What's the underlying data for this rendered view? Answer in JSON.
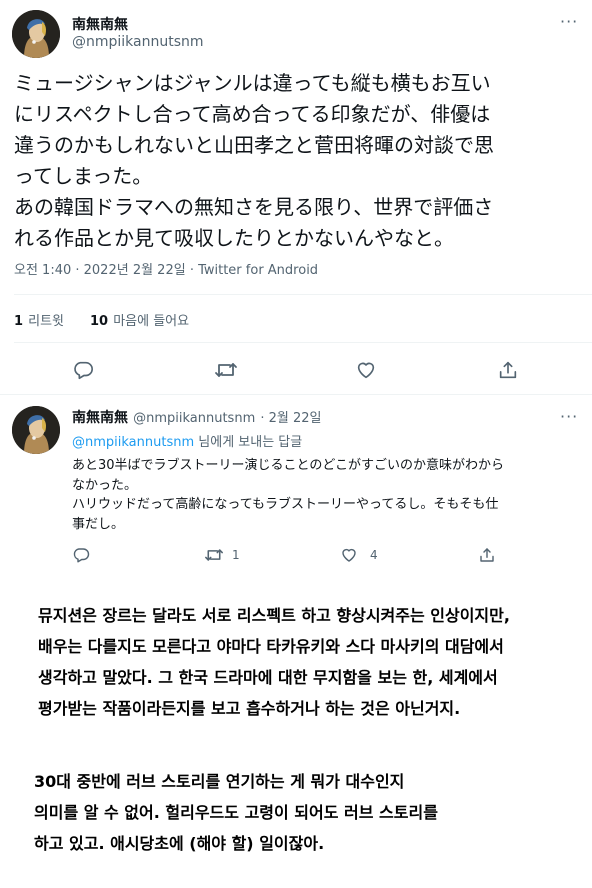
{
  "main_tweet": {
    "display_name": "南無南無",
    "handle": "@nmpiikannutsnm",
    "text": "ミュージシャンはジャンルは違っても縦も横もお互い\nにリスペクトし合って高め合ってる印象だが、俳優は\n違うのかもしれないと山田孝之と菅田将暉の対談で思\nってしまった。\nあの韓国ドラマへの無知さを見る限り、世界で評価さ\nれる作品とか見て吸収したりとかないんやなと。",
    "timestamp": "오전 1:40 · 2022년 2월 22일 · Twitter for Android",
    "retweets_count": "1",
    "retweets_label": "리트윗",
    "likes_count": "10",
    "likes_label": "마음에 들어요"
  },
  "reply_tweet": {
    "display_name": "南無南無",
    "handle": "@nmpiikannutsnm",
    "date": "· 2월 22일",
    "reply_to_mention": "@nmpiikannutsnm",
    "reply_to_suffix": " 님에게 보내는 답글",
    "text": "あと30半ばでラブストーリー演じることのどこがすごいのか意味がわから\nなかった。\nハリウッドだって高齢になってもラブストーリーやってるし。そもそも仕\n事だし。",
    "retweets_count": "1",
    "likes_count": "4"
  },
  "translation": {
    "paragraph1": "뮤지션은 장르는 달라도 서로 리스펙트 하고 향상시켜주는 인상이지만,\n배우는 다를지도 모른다고 야마다 타카유키와 스다 마사키의 대담에서\n생각하고 말았다. 그 한국 드라마에 대한 무지함을 보는 한, 세계에서\n평가받는 작품이라든지를 보고 흡수하거나 하는 것은 아닌거지.",
    "paragraph2": "30대 중반에 러브 스토리를 연기하는 게 뭐가 대수인지\n의미를 알 수 없어. 헐리우드도 고령이 되어도 러브 스토리를\n하고 있고. 애시당초에 (해야 할) 일이잖아."
  },
  "icons": [
    "more-icon",
    "reply-icon",
    "retweet-icon",
    "like-icon",
    "share-icon"
  ]
}
